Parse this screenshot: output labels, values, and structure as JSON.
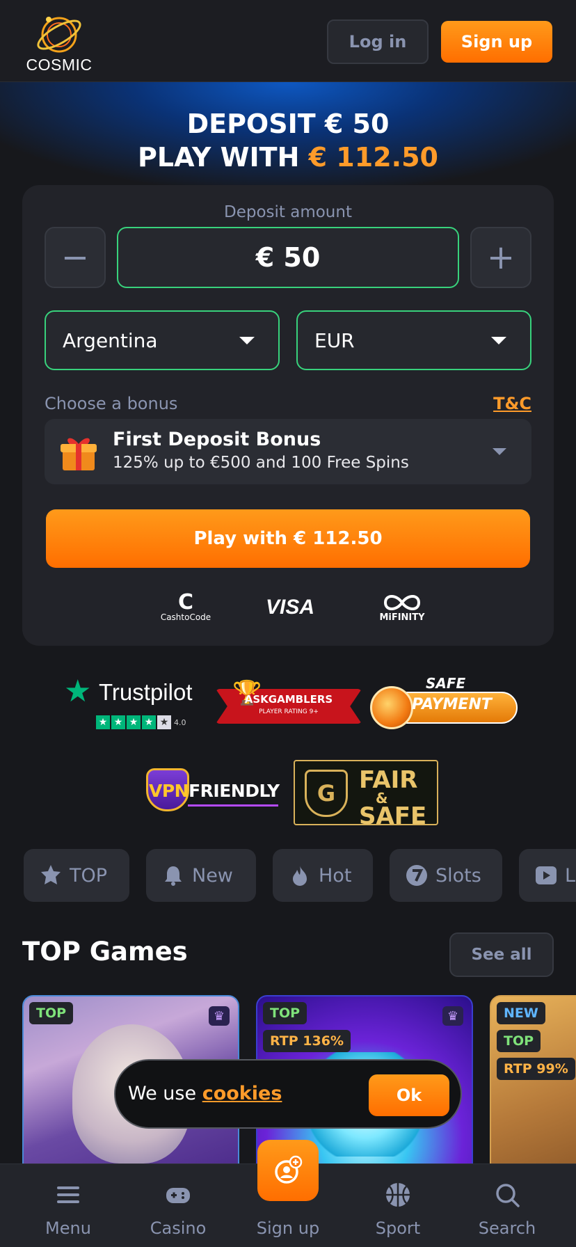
{
  "header": {
    "logo_text": "COSMIC",
    "login_label": "Log in",
    "signup_label": "Sign up"
  },
  "hero": {
    "line1": "DEPOSIT € 50",
    "line2_prefix": "PLAY WITH",
    "line2_amount": "€ 112.50"
  },
  "deposit": {
    "label": "Deposit amount",
    "minus_symbol": "−",
    "plus_symbol": "+",
    "amount": "€ 50",
    "country": "Argentina",
    "currency": "EUR",
    "bonus_label": "Choose a bonus",
    "tc_label": "T&C",
    "bonus_title": "First Deposit Bonus",
    "bonus_desc": "125% up to €500 and 100 Free Spins",
    "play_label": "Play with € 112.50",
    "payment_methods": {
      "cashtocode_big": "C",
      "cashtocode": "CashtoCode",
      "visa": "VISA",
      "mifinity": "MiFINITY"
    }
  },
  "badges": {
    "trustpilot": "Trustpilot",
    "trustpilot_score": "4.0",
    "trustpilot_rating": 4.0,
    "askgamblers": "ASKGAMBLERS",
    "askgamblers_sub": "PLAYER RATING 9+",
    "safe_top": "SAFE",
    "safe_payment": "PAYMENT",
    "vpn_v": "VPN",
    "vpn_friendly": "FRIENDLY",
    "fair_g": "G",
    "fair_line1": "FAIR",
    "fair_line2": "&",
    "fair_line3": "SAFE"
  },
  "chips": [
    {
      "label": "TOP",
      "icon": "star-badge-icon"
    },
    {
      "label": "New",
      "icon": "bell-icon"
    },
    {
      "label": "Hot",
      "icon": "flame-icon"
    },
    {
      "label": "Slots",
      "icon": "seven-icon"
    },
    {
      "label": "L",
      "icon": "play-icon"
    }
  ],
  "top_games": {
    "title": "TOP Games",
    "see_all": "See all",
    "games": [
      {
        "tags": [
          "TOP"
        ],
        "icon": "trophy-icon"
      },
      {
        "tags": [
          "TOP",
          "RTP 136%"
        ],
        "icon": "trophy-icon"
      },
      {
        "tags": [
          "NEW",
          "TOP",
          "RTP 99%"
        ]
      }
    ]
  },
  "cookie": {
    "prefix": "We use",
    "link": "cookies",
    "ok": "Ok"
  },
  "bottom_nav": [
    {
      "label": "Menu",
      "icon": "menu-icon"
    },
    {
      "label": "Casino",
      "icon": "gamepad-icon"
    },
    {
      "label": "Sign up",
      "icon": "user-plus-icon"
    },
    {
      "label": "Sport",
      "icon": "basketball-icon"
    },
    {
      "label": "Search",
      "icon": "search-icon"
    }
  ],
  "colors": {
    "accent": "#ff7a0a",
    "success_border": "#38d27c",
    "background": "#17181c",
    "muted_text": "#8a94b0"
  }
}
